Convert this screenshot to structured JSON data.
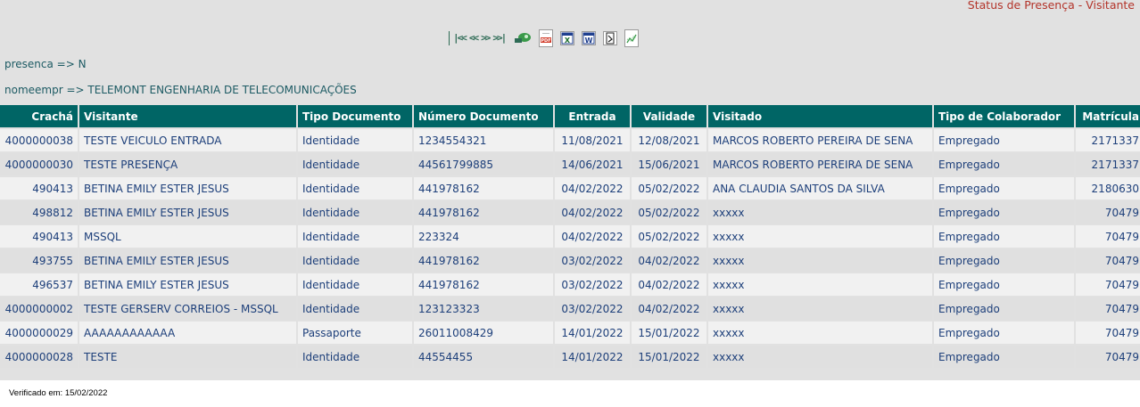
{
  "header": {
    "title": "Status de Presença - Visitante"
  },
  "toolbar": {
    "first": "|<<",
    "prev": "<<",
    "next": ">>",
    "last": ">>|",
    "icons": [
      "refresh-icon",
      "pdf-icon",
      "excel-icon",
      "word-icon",
      "print-icon",
      "chart-icon"
    ]
  },
  "filters": {
    "presenca": "presenca => N",
    "nomeempr": "nomeempr => TELEMONT ENGENHARIA DE TELECOMUNICAÇÕES"
  },
  "table": {
    "columns": [
      "Crachá",
      "Visitante",
      "Tipo Documento",
      "Número Documento",
      "Entrada",
      "Validade",
      "Visitado",
      "Tipo de Colaborador",
      "Matrícula"
    ],
    "rows": [
      [
        "4000000038",
        "TESTE VEICULO ENTRADA",
        "Identidade",
        "1234554321",
        "11/08/2021",
        "12/08/2021",
        "MARCOS ROBERTO PEREIRA DE SENA",
        "Empregado",
        "2171337"
      ],
      [
        "4000000030",
        "TESTE PRESENÇA",
        "Identidade",
        "44561799885",
        "14/06/2021",
        "15/06/2021",
        "MARCOS ROBERTO PEREIRA DE SENA",
        "Empregado",
        "2171337"
      ],
      [
        "490413",
        "BETINA EMILY ESTER JESUS",
        "Identidade",
        "441978162",
        "04/02/2022",
        "05/02/2022",
        "ANA CLAUDIA SANTOS DA SILVA",
        "Empregado",
        "2180630"
      ],
      [
        "498812",
        "BETINA EMILY ESTER JESUS",
        "Identidade",
        "441978162",
        "04/02/2022",
        "05/02/2022",
        "xxxxx",
        "Empregado",
        "70479"
      ],
      [
        "490413",
        "MSSQL",
        "Identidade",
        "223324",
        "04/02/2022",
        "05/02/2022",
        "xxxxx",
        "Empregado",
        "70479"
      ],
      [
        "493755",
        "BETINA EMILY ESTER JESUS",
        "Identidade",
        "441978162",
        "03/02/2022",
        "04/02/2022",
        "xxxxx",
        "Empregado",
        "70479"
      ],
      [
        "496537",
        "BETINA EMILY ESTER JESUS",
        "Identidade",
        "441978162",
        "03/02/2022",
        "04/02/2022",
        "xxxxx",
        "Empregado",
        "70479"
      ],
      [
        "4000000002",
        "TESTE GERSERV CORREIOS - MSSQL",
        "Identidade",
        "123123323",
        "03/02/2022",
        "04/02/2022",
        "xxxxx",
        "Empregado",
        "70479"
      ],
      [
        "4000000029",
        "AAAAAAAAAAAA",
        "Passaporte",
        "26011008429",
        "14/01/2022",
        "15/01/2022",
        "xxxxx",
        "Empregado",
        "70479"
      ],
      [
        "4000000028",
        "TESTE",
        "Identidade",
        "44554455",
        "14/01/2022",
        "15/01/2022",
        "xxxxx",
        "Empregado",
        "70479"
      ]
    ]
  },
  "footer": {
    "verified": "Verificado em: 15/02/2022"
  },
  "colors": {
    "header_bg": "#006565",
    "title": "#b3342a",
    "link": "#1d3f7a"
  }
}
